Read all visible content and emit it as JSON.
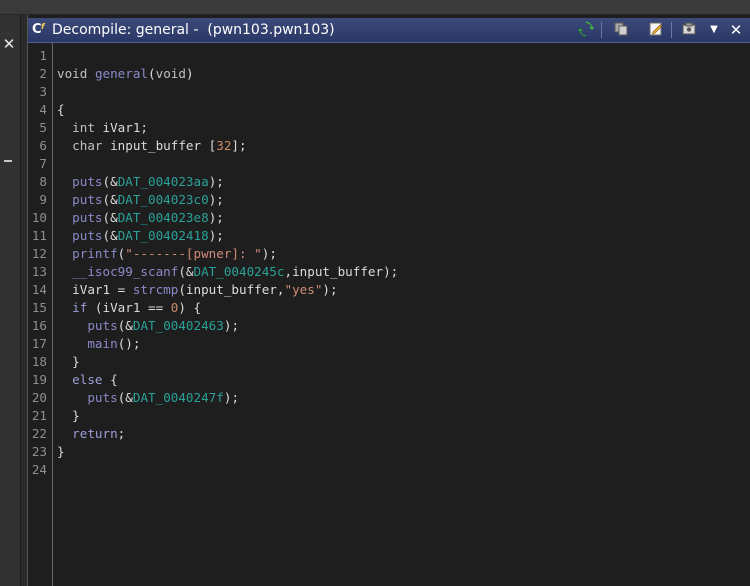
{
  "left_panel": {
    "close_glyph": "✕"
  },
  "panel": {
    "title": "Decompile: general -  (pwn103.pwn103)",
    "toolbar": {
      "refresh_icon": "refresh-icon",
      "copy_icon": "copy-icon",
      "edit_icon": "edit-icon",
      "snapshot_icon": "snapshot-icon",
      "menu_icon": "chevron-down-icon",
      "close_glyph": "✕"
    }
  },
  "colors": {
    "title_bg": "#2f3c6c",
    "keyword": "#c0c0c0",
    "function": "#8a8ac8",
    "data_ref": "#2aa198",
    "string": "#d28a78",
    "number": "#c98c6a"
  },
  "code": {
    "lines": [
      {
        "num": "1",
        "tokens": []
      },
      {
        "num": "2",
        "tokens": [
          {
            "t": "void",
            "c": "kw"
          },
          {
            "t": " "
          },
          {
            "t": "general",
            "c": "func"
          },
          {
            "t": "("
          },
          {
            "t": "void",
            "c": "kw"
          },
          {
            "t": ")"
          }
        ]
      },
      {
        "num": "3",
        "tokens": []
      },
      {
        "num": "4",
        "tokens": [
          {
            "t": "{"
          }
        ]
      },
      {
        "num": "5",
        "tokens": [
          {
            "t": "  "
          },
          {
            "t": "int",
            "c": "kw"
          },
          {
            "t": " iVar1;"
          }
        ]
      },
      {
        "num": "6",
        "tokens": [
          {
            "t": "  "
          },
          {
            "t": "char",
            "c": "kw"
          },
          {
            "t": " input_buffer ["
          },
          {
            "t": "32",
            "c": "num"
          },
          {
            "t": "];"
          }
        ]
      },
      {
        "num": "7",
        "tokens": []
      },
      {
        "num": "8",
        "tokens": [
          {
            "t": "  "
          },
          {
            "t": "puts",
            "c": "func"
          },
          {
            "t": "(&"
          },
          {
            "t": "DAT_004023aa",
            "c": "dat"
          },
          {
            "t": ");"
          }
        ]
      },
      {
        "num": "9",
        "tokens": [
          {
            "t": "  "
          },
          {
            "t": "puts",
            "c": "func"
          },
          {
            "t": "(&"
          },
          {
            "t": "DAT_004023c0",
            "c": "dat"
          },
          {
            "t": ");"
          }
        ]
      },
      {
        "num": "10",
        "tokens": [
          {
            "t": "  "
          },
          {
            "t": "puts",
            "c": "func"
          },
          {
            "t": "(&"
          },
          {
            "t": "DAT_004023e8",
            "c": "dat"
          },
          {
            "t": ");"
          }
        ]
      },
      {
        "num": "11",
        "tokens": [
          {
            "t": "  "
          },
          {
            "t": "puts",
            "c": "func"
          },
          {
            "t": "(&"
          },
          {
            "t": "DAT_00402418",
            "c": "dat"
          },
          {
            "t": ");"
          }
        ]
      },
      {
        "num": "12",
        "tokens": [
          {
            "t": "  "
          },
          {
            "t": "printf",
            "c": "func"
          },
          {
            "t": "("
          },
          {
            "t": "\"-------[pwner]: \"",
            "c": "str"
          },
          {
            "t": ");"
          }
        ]
      },
      {
        "num": "13",
        "tokens": [
          {
            "t": "  "
          },
          {
            "t": "__isoc99_scanf",
            "c": "func"
          },
          {
            "t": "(&"
          },
          {
            "t": "DAT_0040245c",
            "c": "dat"
          },
          {
            "t": ",input_buffer);"
          }
        ]
      },
      {
        "num": "14",
        "tokens": [
          {
            "t": "  iVar1 = "
          },
          {
            "t": "strcmp",
            "c": "func"
          },
          {
            "t": "(input_buffer,"
          },
          {
            "t": "\"yes\"",
            "c": "str"
          },
          {
            "t": ");"
          }
        ]
      },
      {
        "num": "15",
        "tokens": [
          {
            "t": "  "
          },
          {
            "t": "if",
            "c": "ret"
          },
          {
            "t": " (iVar1 == "
          },
          {
            "t": "0",
            "c": "num"
          },
          {
            "t": ") {"
          }
        ]
      },
      {
        "num": "16",
        "tokens": [
          {
            "t": "    "
          },
          {
            "t": "puts",
            "c": "func"
          },
          {
            "t": "(&"
          },
          {
            "t": "DAT_00402463",
            "c": "dat"
          },
          {
            "t": ");"
          }
        ]
      },
      {
        "num": "17",
        "tokens": [
          {
            "t": "    "
          },
          {
            "t": "main",
            "c": "func"
          },
          {
            "t": "();"
          }
        ]
      },
      {
        "num": "18",
        "tokens": [
          {
            "t": "  }"
          }
        ]
      },
      {
        "num": "19",
        "tokens": [
          {
            "t": "  "
          },
          {
            "t": "else",
            "c": "ret"
          },
          {
            "t": " {"
          }
        ]
      },
      {
        "num": "20",
        "tokens": [
          {
            "t": "    "
          },
          {
            "t": "puts",
            "c": "func"
          },
          {
            "t": "(&"
          },
          {
            "t": "DAT_0040247f",
            "c": "dat"
          },
          {
            "t": ");"
          }
        ]
      },
      {
        "num": "21",
        "tokens": [
          {
            "t": "  }"
          }
        ]
      },
      {
        "num": "22",
        "tokens": [
          {
            "t": "  "
          },
          {
            "t": "return",
            "c": "ret"
          },
          {
            "t": ";"
          }
        ]
      },
      {
        "num": "23",
        "tokens": [
          {
            "t": "}"
          }
        ]
      },
      {
        "num": "24",
        "tokens": []
      }
    ]
  }
}
